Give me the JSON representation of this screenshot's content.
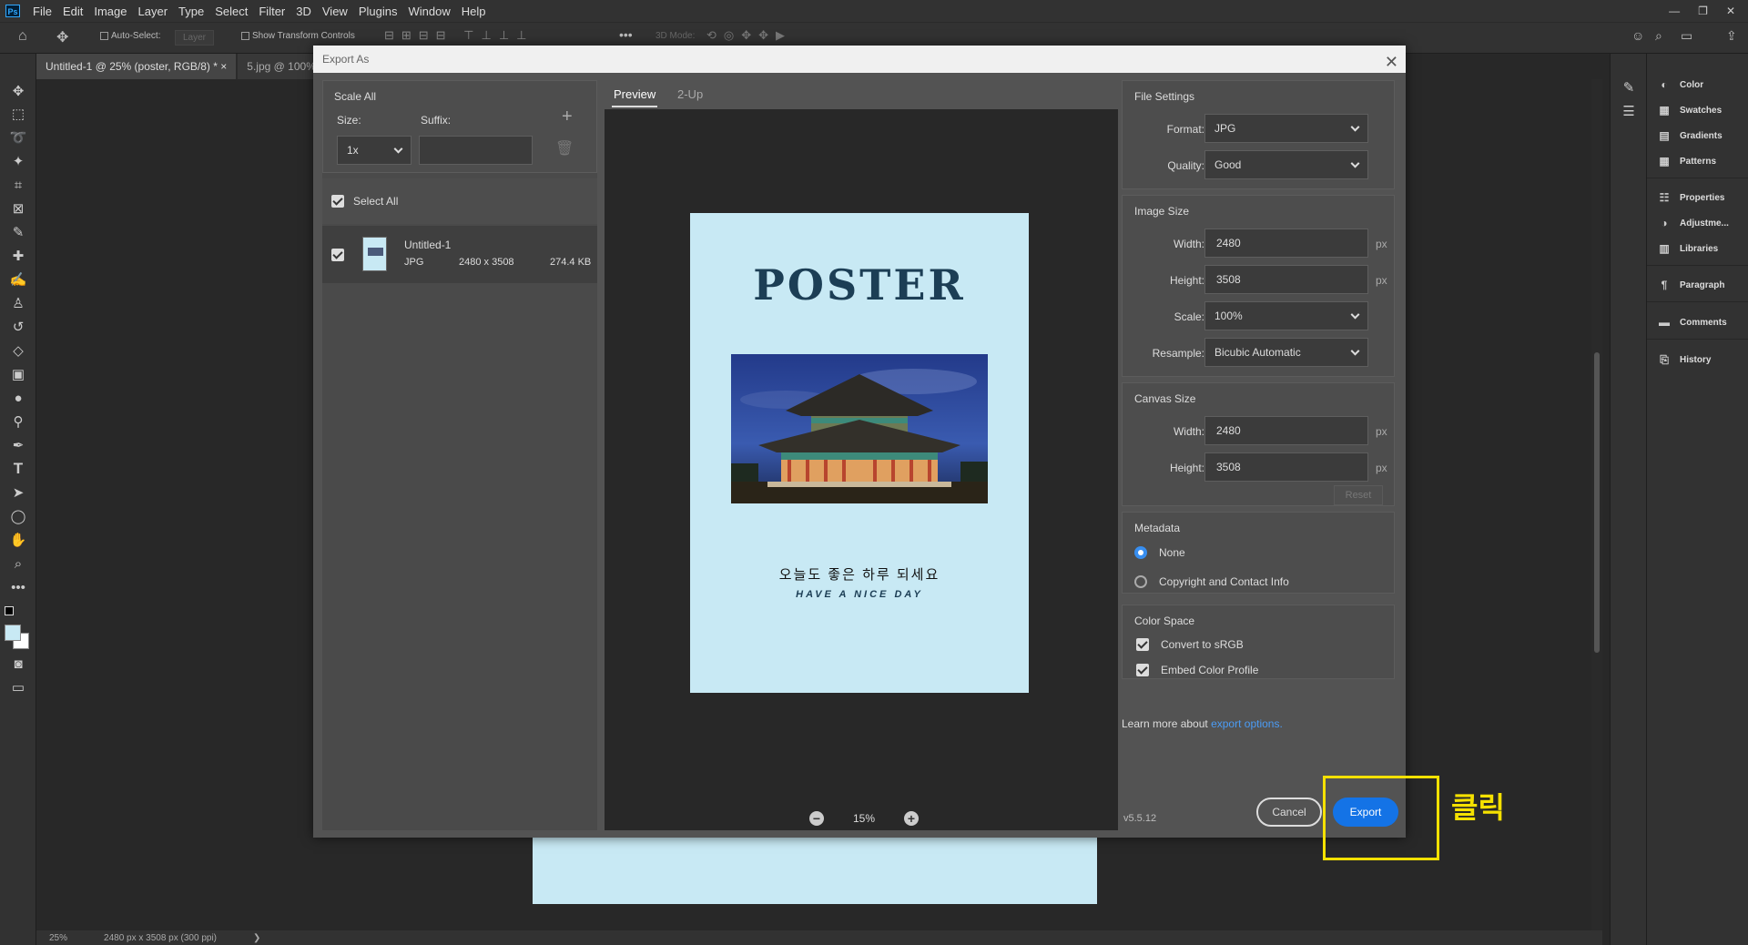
{
  "app": {
    "logo": "Ps",
    "menu": [
      "File",
      "Edit",
      "Image",
      "Layer",
      "Type",
      "Select",
      "Filter",
      "3D",
      "View",
      "Plugins",
      "Window",
      "Help"
    ],
    "window_controls": [
      "—",
      "❐",
      "✕"
    ]
  },
  "options_bar": {
    "auto_select_label": "Auto-Select:",
    "auto_select_value": "Layer",
    "show_transform_label": "Show Transform Controls",
    "mode_3d_label": "3D Mode:"
  },
  "doc_tabs": [
    {
      "label": "Untitled-1 @ 25% (poster, RGB/8) *",
      "close": "×"
    },
    {
      "label": "5.jpg @ 100%",
      "close": ""
    }
  ],
  "status": {
    "zoom": "25%",
    "doc_info": "2480 px x 3508 px (300 ppi)",
    "arrow": "❯"
  },
  "panels": [
    "Color",
    "Swatches",
    "Gradients",
    "Patterns",
    "Properties",
    "Adjustme...",
    "Libraries",
    "Paragraph",
    "Comments",
    "History"
  ],
  "dialog": {
    "title": "Export As",
    "close": "✕",
    "scale_all": {
      "title": "Scale All",
      "size_label": "Size:",
      "suffix_label": "Suffix:",
      "size_value": "1x",
      "suffix_value": ""
    },
    "select_all_label": "Select All",
    "asset": {
      "name": "Untitled-1",
      "format": "JPG",
      "dims": "2480 x 3508",
      "filesize": "274.4 KB"
    },
    "tabs": {
      "preview": "Preview",
      "two_up": "2-Up"
    },
    "poster": {
      "title": "POSTER",
      "korean": "오늘도 좋은 하루 되세요",
      "english": "HAVE A NICE DAY"
    },
    "zoom": {
      "minus": "−",
      "value": "15%",
      "plus": "+"
    },
    "file_settings": {
      "title": "File Settings",
      "format_label": "Format:",
      "format_value": "JPG",
      "quality_label": "Quality:",
      "quality_value": "Good"
    },
    "image_size": {
      "title": "Image Size",
      "width_label": "Width:",
      "width_value": "2480",
      "height_label": "Height:",
      "height_value": "3508",
      "scale_label": "Scale:",
      "scale_value": "100%",
      "resample_label": "Resample:",
      "resample_value": "Bicubic Automatic",
      "unit": "px"
    },
    "canvas_size": {
      "title": "Canvas Size",
      "width_label": "Width:",
      "width_value": "2480",
      "height_label": "Height:",
      "height_value": "3508",
      "unit": "px",
      "reset_label": "Reset"
    },
    "metadata": {
      "title": "Metadata",
      "none_label": "None",
      "copyright_label": "Copyright and Contact Info"
    },
    "color_space": {
      "title": "Color Space",
      "srgb_label": "Convert to sRGB",
      "embed_label": "Embed Color Profile"
    },
    "learn_more_text": "Learn more about",
    "learn_more_link": "export options.",
    "version": "v5.5.12",
    "cancel_label": "Cancel",
    "export_label": "Export"
  },
  "annotation_text": "클릭",
  "colors": {
    "accent": "#1473e6",
    "highlight": "#f5e100",
    "poster_bg": "#c8e9f4"
  }
}
